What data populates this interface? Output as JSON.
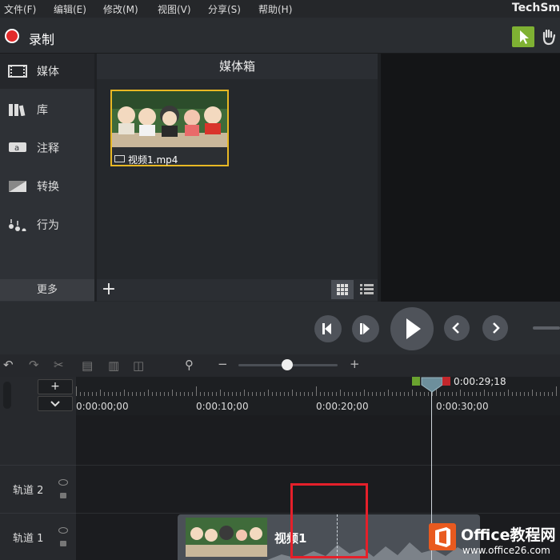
{
  "menu": {
    "items": [
      "文件(F)",
      "编辑(E)",
      "修改(M)",
      "视图(V)",
      "分享(S)",
      "帮助(H)"
    ],
    "brand": "TechSm"
  },
  "record": {
    "label": "录制"
  },
  "sidebar": {
    "items": [
      {
        "label": "媒体",
        "icon": "film-icon",
        "active": true
      },
      {
        "label": "库",
        "icon": "library-icon",
        "active": false
      },
      {
        "label": "注释",
        "icon": "annotation-icon",
        "active": false
      },
      {
        "label": "转换",
        "icon": "transition-icon",
        "active": false
      },
      {
        "label": "行为",
        "icon": "behavior-icon",
        "active": false
      }
    ],
    "more_label": "更多"
  },
  "media_bin": {
    "title": "媒体箱",
    "item_label": "视频1.mp4"
  },
  "timeline": {
    "ruler_ticks": [
      "0:00:00;00",
      "0:00:10;00",
      "0:00:20;00",
      "0:00:30;00"
    ],
    "playhead_time": "0:00:29;18",
    "tracks": [
      "轨道 2",
      "轨道 1"
    ],
    "clip_title": "视频1"
  },
  "watermark": {
    "title": "Office教程网",
    "url": "www.office26.com"
  },
  "colors": {
    "accent_green": "#7fb133",
    "record_red": "#e32b2b",
    "thumb_border": "#e8b824",
    "highlight_box": "#e5202a"
  }
}
